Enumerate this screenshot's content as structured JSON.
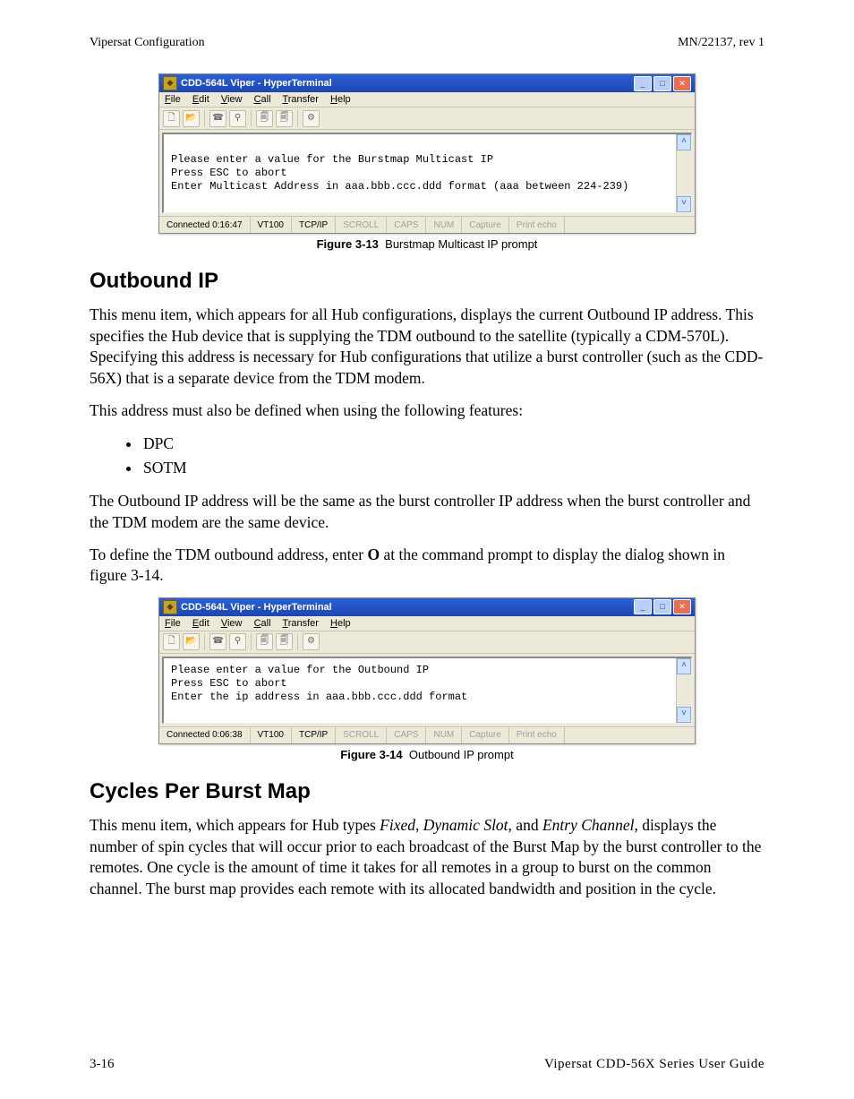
{
  "header": {
    "left": "Vipersat Configuration",
    "right": "MN/22137, rev 1"
  },
  "footer": {
    "left": "3-16",
    "right": "Vipersat CDD-56X Series User Guide"
  },
  "figures": {
    "f13": {
      "label": "Figure 3-13",
      "caption": "Burstmap Multicast IP prompt"
    },
    "f14": {
      "label": "Figure 3-14",
      "caption": "Outbound IP prompt"
    }
  },
  "sections": {
    "outbound": {
      "title": "Outbound IP",
      "p1": "This menu item, which appears for all Hub configurations, displays the current Outbound IP address. This specifies the Hub device that is supplying the TDM outbound to the satellite (typically a CDM-570L). Specifying this address is necessary for Hub configurations that utilize a burst controller (such as the CDD-56X) that is a separate device from the TDM modem.",
      "p2": "This address must also be defined when using the following features:",
      "bullets": [
        "DPC",
        "SOTM"
      ],
      "p3": "The Outbound IP address will be the same as the burst controller IP address when the burst controller and the TDM modem are the same device.",
      "p4_pre": "To define the TDM outbound address, enter ",
      "p4_bold": "O",
      "p4_post": " at the command prompt to display the dialog shown in figure 3-14."
    },
    "cycles": {
      "title": "Cycles Per Burst Map",
      "p1_pre": "This menu item, which appears for Hub types ",
      "p1_i1": "Fixed",
      "p1_s1": ", ",
      "p1_i2": "Dynamic Slot",
      "p1_s2": ", and ",
      "p1_i3": "Entry Channel",
      "p1_post": ", displays the number of spin cycles that will occur prior to each broadcast of the Burst Map by the burst controller to the remotes. One cycle is the amount of time it takes for all remotes in a group to burst on the common channel. The burst map provides each remote with its allocated bandwidth and position in the cycle."
    }
  },
  "terminal_common": {
    "title": "CDD-564L Viper - HyperTerminal",
    "menu": {
      "file": "File",
      "edit": "Edit",
      "view": "View",
      "call": "Call",
      "transfer": "Transfer",
      "help": "Help"
    },
    "status_fields": {
      "emu": "VT100",
      "proto": "TCP/IP",
      "scroll": "SCROLL",
      "caps": "CAPS",
      "num": "NUM",
      "capture": "Capture",
      "print": "Print echo"
    }
  },
  "terminal1": {
    "connected": "Connected 0:16:47",
    "lines": "\nPlease enter a value for the Burstmap Multicast IP\nPress ESC to abort\nEnter Multicast Address in aaa.bbb.ccc.ddd format (aaa between 224-239)\n "
  },
  "terminal2": {
    "connected": "Connected 0:06:38",
    "lines": "Please enter a value for the Outbound IP\nPress ESC to abort\nEnter the ip address in aaa.bbb.ccc.ddd format\n "
  }
}
